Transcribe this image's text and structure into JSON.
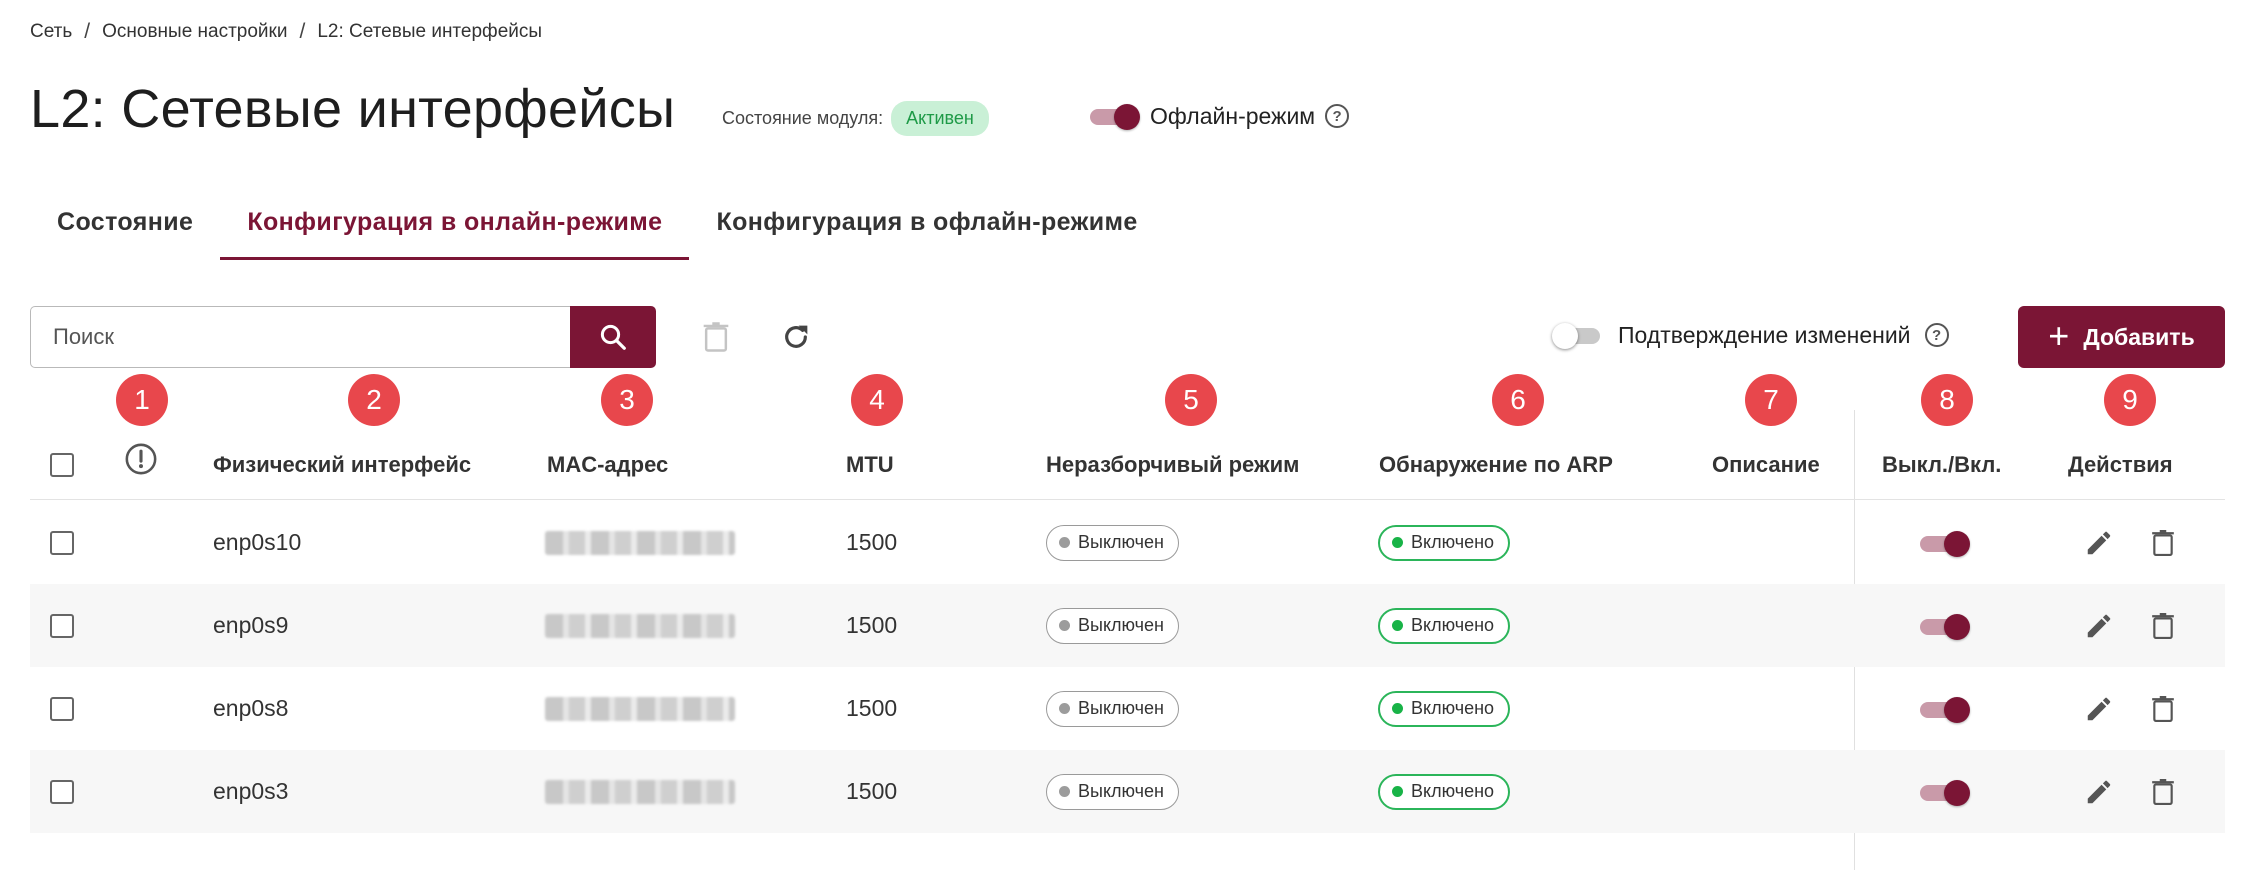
{
  "breadcrumb": {
    "items": [
      "Сеть",
      "Основные настройки",
      "L2: Сетевые интерфейсы"
    ],
    "separator": "/"
  },
  "page": {
    "title": "L2: Сетевые интерфейсы",
    "module_state_label": "Состояние модуля:",
    "module_state_value": "Активен",
    "offline_mode_label": "Офлайн-режим",
    "offline_mode_on": true
  },
  "tabs": [
    {
      "label": "Состояние",
      "active": false
    },
    {
      "label": "Конфигурация в онлайн-режиме",
      "active": true
    },
    {
      "label": "Конфигурация в офлайн-режиме",
      "active": false
    }
  ],
  "toolbar": {
    "search_placeholder": "Поиск",
    "confirm_changes_label": "Подтверждение изменений",
    "confirm_changes_on": false,
    "add_label": "Добавить",
    "icons": [
      "search-icon",
      "trash-icon",
      "refresh-icon",
      "help-icon",
      "plus-icon"
    ]
  },
  "markers": [
    "1",
    "2",
    "3",
    "4",
    "5",
    "6",
    "7",
    "8",
    "9"
  ],
  "table": {
    "headers": {
      "warning": "!",
      "interface": "Физический интерфейс",
      "mac": "MAC-адрес",
      "mtu": "MTU",
      "promisc": "Неразборчивый режим",
      "arp": "Обнаружение по ARP",
      "description": "Описание",
      "toggle": "Выкл./Вкл.",
      "actions": "Действия"
    },
    "rows": [
      {
        "interface": "enp0s10",
        "mtu": "1500",
        "promisc": "Выключен",
        "arp": "Включено",
        "description": "",
        "enabled": true
      },
      {
        "interface": "enp0s9",
        "mtu": "1500",
        "promisc": "Выключен",
        "arp": "Включено",
        "description": "",
        "enabled": true
      },
      {
        "interface": "enp0s8",
        "mtu": "1500",
        "promisc": "Выключен",
        "arp": "Включено",
        "description": "",
        "enabled": true
      },
      {
        "interface": "enp0s3",
        "mtu": "1500",
        "promisc": "Выключен",
        "arp": "Включено",
        "description": "",
        "enabled": true
      }
    ]
  },
  "colors": {
    "brand": "#7b1535",
    "marker": "#e8474c",
    "active_badge_bg": "#c9f0d6",
    "active_badge_text": "#1e9a47",
    "enabled_green": "#2bb55a"
  }
}
